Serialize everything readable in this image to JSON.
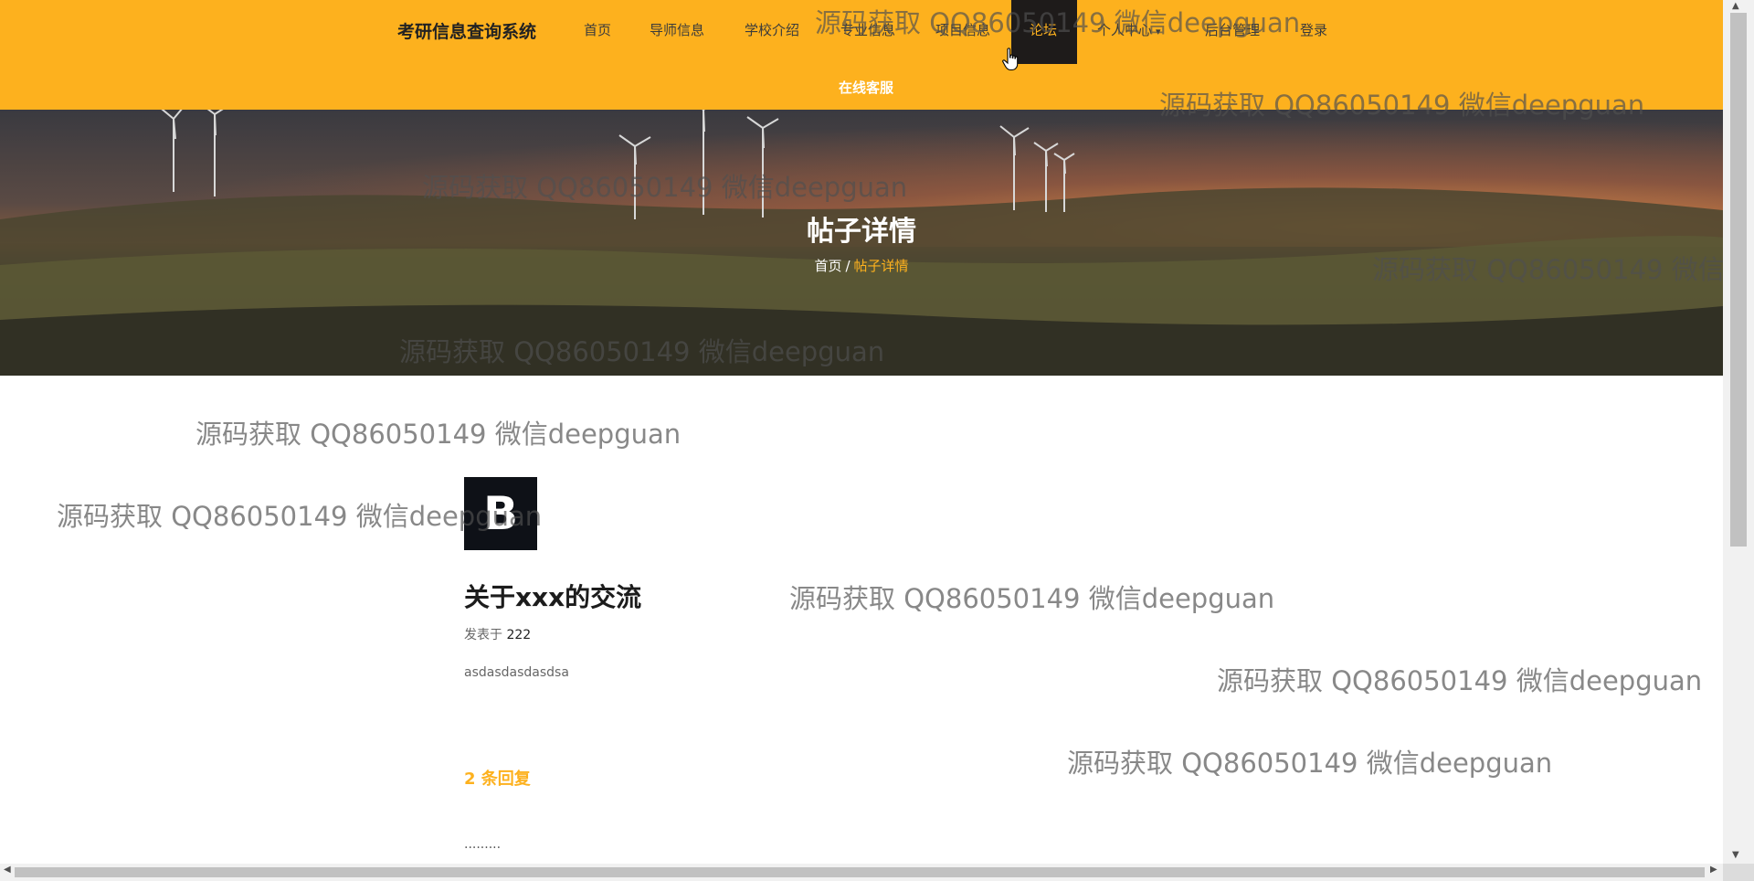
{
  "header": {
    "brand": "考研信息查询系统",
    "nav": [
      {
        "label": "首页"
      },
      {
        "label": "导师信息"
      },
      {
        "label": "学校介绍"
      },
      {
        "label": "专业信息"
      },
      {
        "label": "项目信息"
      },
      {
        "label": "论坛",
        "active": true
      },
      {
        "label": "个人中心",
        "dropdown": true
      },
      {
        "label": "后台管理"
      },
      {
        "label": "登录"
      }
    ],
    "online_service": "在线客服"
  },
  "banner": {
    "title": "帖子详情",
    "breadcrumb": {
      "home": "首页",
      "separator": "/",
      "current": "帖子详情"
    }
  },
  "post": {
    "logo_letter": "B",
    "title": "关于xxx的交流",
    "meta_prefix": "发表于",
    "author": "222",
    "content": "asdasdasdasdsa",
    "reply_count_label": "2 条回复",
    "first_reply": "........."
  },
  "watermark": {
    "text": "源码获取 QQ86050149 微信deepguan"
  },
  "colors": {
    "accent": "#fdb11e",
    "active_nav_bg": "#1e1b1a",
    "logo_bg": "#0e1117"
  }
}
